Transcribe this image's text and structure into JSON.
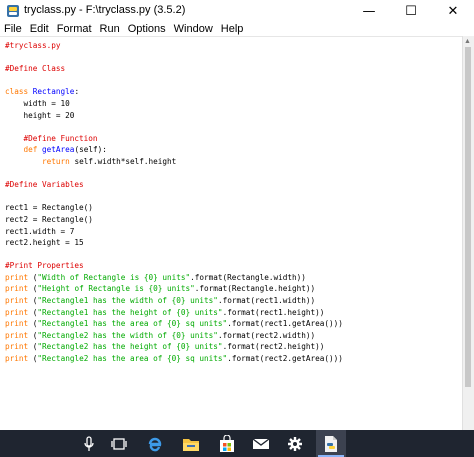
{
  "window": {
    "title": "tryclass.py - F:\\tryclass.py (3.5.2)"
  },
  "menu": [
    {
      "label": "File"
    },
    {
      "label": "Edit"
    },
    {
      "label": "Format"
    },
    {
      "label": "Run"
    },
    {
      "label": "Options"
    },
    {
      "label": "Window"
    },
    {
      "label": "Help"
    }
  ],
  "editor": {
    "lines": [
      [
        {
          "t": "#tryclass.py",
          "c": "comment"
        }
      ],
      [],
      [
        {
          "t": "#Define Class",
          "c": "comment"
        }
      ],
      [],
      [
        {
          "t": "class ",
          "c": "kw"
        },
        {
          "t": "Rectangle",
          "c": "def"
        },
        {
          "t": ":",
          "c": "plain"
        }
      ],
      [
        {
          "t": "    width = 10",
          "c": "plain"
        }
      ],
      [
        {
          "t": "    height = 20",
          "c": "plain"
        }
      ],
      [],
      [
        {
          "t": "    #Define Function",
          "c": "comment"
        }
      ],
      [
        {
          "t": "    ",
          "c": "plain"
        },
        {
          "t": "def ",
          "c": "kw"
        },
        {
          "t": "getArea",
          "c": "def"
        },
        {
          "t": "(self):",
          "c": "plain"
        }
      ],
      [
        {
          "t": "        ",
          "c": "plain"
        },
        {
          "t": "return",
          "c": "kw"
        },
        {
          "t": " self.width*self.height",
          "c": "plain"
        }
      ],
      [],
      [
        {
          "t": "#Define Variables",
          "c": "comment"
        }
      ],
      [],
      [
        {
          "t": "rect1 = Rectangle()",
          "c": "plain"
        }
      ],
      [
        {
          "t": "rect2 = Rectangle()",
          "c": "plain"
        }
      ],
      [
        {
          "t": "rect1.width = 7",
          "c": "plain"
        }
      ],
      [
        {
          "t": "rect2.height = 15",
          "c": "plain"
        }
      ],
      [],
      [
        {
          "t": "#Print Properties",
          "c": "comment"
        }
      ],
      [
        {
          "t": "print",
          "c": "kw"
        },
        {
          "t": " (",
          "c": "plain"
        },
        {
          "t": "\"Width of Rectangle is {0} units\"",
          "c": "str"
        },
        {
          "t": ".format(Rectangle.width))",
          "c": "plain"
        }
      ],
      [
        {
          "t": "print",
          "c": "kw"
        },
        {
          "t": " (",
          "c": "plain"
        },
        {
          "t": "\"Height of Rectangle is {0} units\"",
          "c": "str"
        },
        {
          "t": ".format(Rectangle.height))",
          "c": "plain"
        }
      ],
      [
        {
          "t": "print",
          "c": "kw"
        },
        {
          "t": " (",
          "c": "plain"
        },
        {
          "t": "\"Rectangle1 has the width of {0} units\"",
          "c": "str"
        },
        {
          "t": ".format(rect1.width))",
          "c": "plain"
        }
      ],
      [
        {
          "t": "print",
          "c": "kw"
        },
        {
          "t": " (",
          "c": "plain"
        },
        {
          "t": "\"Rectangle1 has the height of {0} units\"",
          "c": "str"
        },
        {
          "t": ".format(rect1.height))",
          "c": "plain"
        }
      ],
      [
        {
          "t": "print",
          "c": "kw"
        },
        {
          "t": " (",
          "c": "plain"
        },
        {
          "t": "\"Rectangle1 has the area of {0} sq units\"",
          "c": "str"
        },
        {
          "t": ".format(rect1.getArea()))",
          "c": "plain"
        }
      ],
      [
        {
          "t": "print",
          "c": "kw"
        },
        {
          "t": " (",
          "c": "plain"
        },
        {
          "t": "\"Rectangle2 has the width of {0} units\"",
          "c": "str"
        },
        {
          "t": ".format(rect2.width))",
          "c": "plain"
        }
      ],
      [
        {
          "t": "print",
          "c": "kw"
        },
        {
          "t": " (",
          "c": "plain"
        },
        {
          "t": "\"Rectangle2 has the height of {0} units\"",
          "c": "str"
        },
        {
          "t": ".format(rect2.height))",
          "c": "plain"
        }
      ],
      [
        {
          "t": "print",
          "c": "kw"
        },
        {
          "t": " (",
          "c": "plain"
        },
        {
          "t": "\"Rectangle2 has the area of {0} sq units\"",
          "c": "str"
        },
        {
          "t": ".format(rect2.getArea()))",
          "c": "plain"
        }
      ]
    ]
  },
  "window_controls": {
    "minimize": "—",
    "maximize": "☐",
    "close": "✕"
  },
  "taskbar": {
    "items": [
      {
        "icon": "microphone-icon",
        "active": false
      },
      {
        "icon": "task-view-icon",
        "active": false
      },
      {
        "icon": "edge-browser-icon",
        "active": false
      },
      {
        "icon": "file-explorer-icon",
        "active": false
      },
      {
        "icon": "store-icon",
        "active": false
      },
      {
        "icon": "mail-icon",
        "active": false
      },
      {
        "icon": "settings-gear-icon",
        "active": false
      },
      {
        "icon": "python-idle-icon",
        "active": true
      }
    ]
  },
  "colors": {
    "comment": "#dd0000",
    "keyword": "#ff7700",
    "definition": "#0000ff",
    "string": "#00aa00",
    "taskbar": "#1f2530"
  }
}
